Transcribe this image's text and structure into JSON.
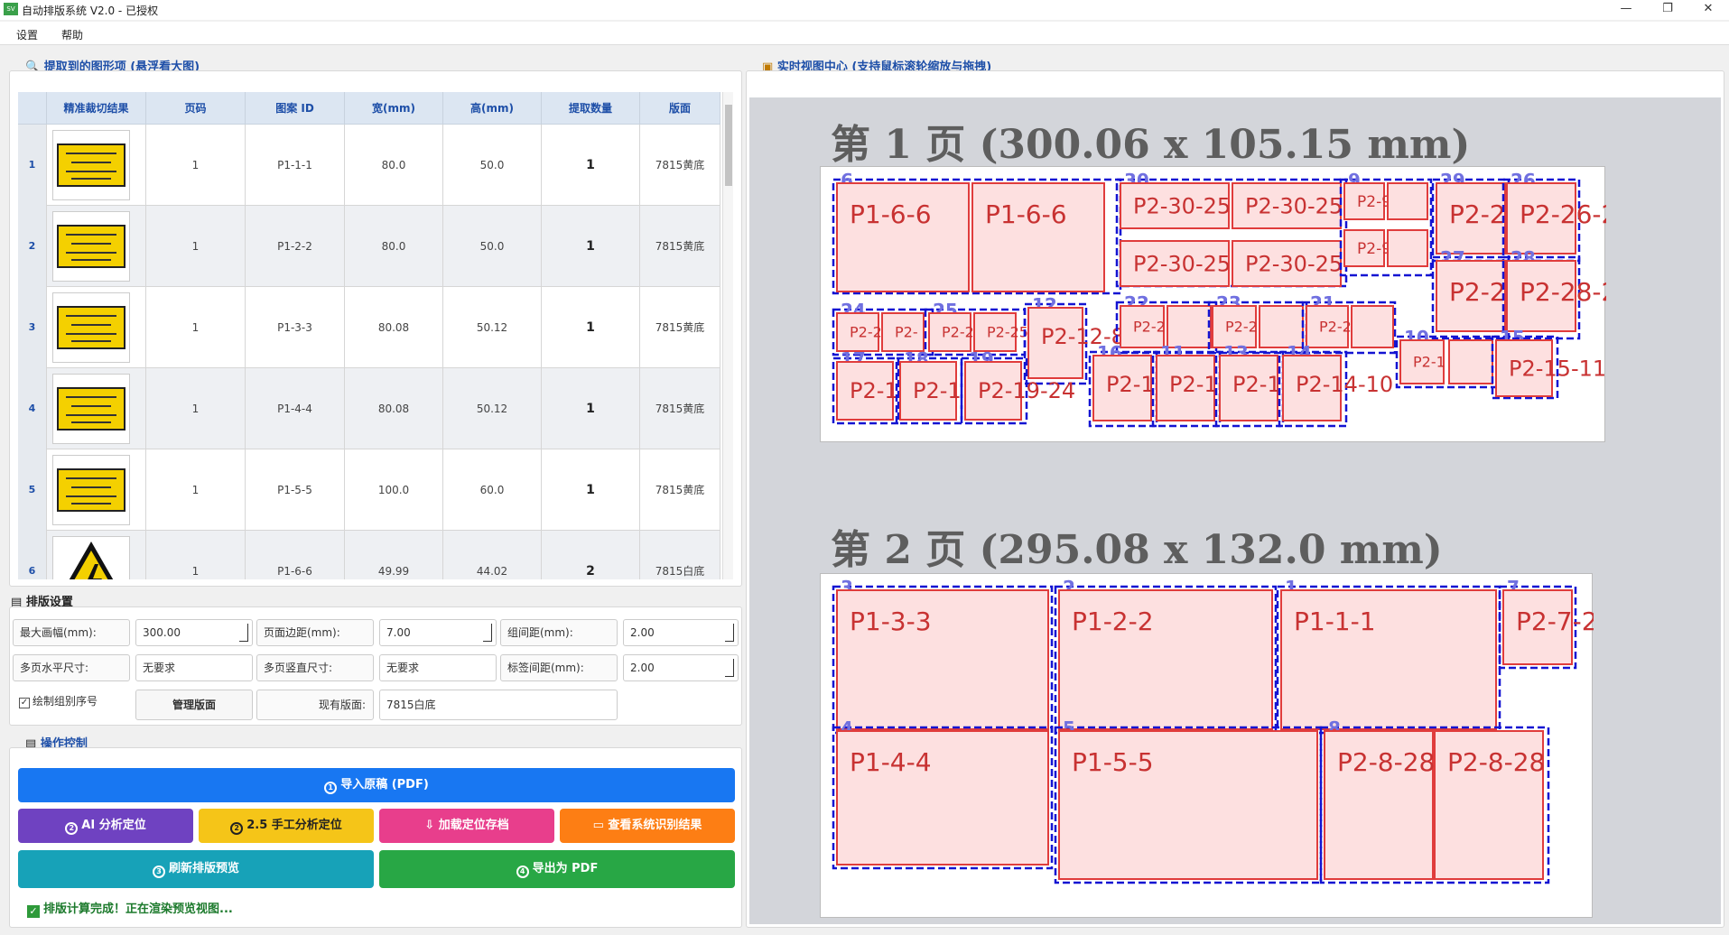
{
  "window": {
    "title": "自动排版系统 V2.0 - 已授权",
    "app_icon": "SV",
    "minimize": "—",
    "maximize": "❐",
    "close": "✕"
  },
  "menu": [
    "设置",
    "帮助"
  ],
  "left": {
    "extract_title": "提取到的图形项 (悬浮看大图)",
    "columns": [
      "",
      "精准裁切结果",
      "页码",
      "图案 ID",
      "宽(mm)",
      "高(mm)",
      "提取数量",
      "版面"
    ],
    "rows": [
      {
        "n": "1",
        "page": "1",
        "id": "P1-1-1",
        "w": "80.0",
        "h": "50.0",
        "qty": "1",
        "layout": "7815黄底"
      },
      {
        "n": "2",
        "page": "1",
        "id": "P1-2-2",
        "w": "80.0",
        "h": "50.0",
        "qty": "1",
        "layout": "7815黄底"
      },
      {
        "n": "3",
        "page": "1",
        "id": "P1-3-3",
        "w": "80.08",
        "h": "50.12",
        "qty": "1",
        "layout": "7815黄底"
      },
      {
        "n": "4",
        "page": "1",
        "id": "P1-4-4",
        "w": "80.08",
        "h": "50.12",
        "qty": "1",
        "layout": "7815黄底"
      },
      {
        "n": "5",
        "page": "1",
        "id": "P1-5-5",
        "w": "100.0",
        "h": "60.0",
        "qty": "1",
        "layout": "7815黄底"
      },
      {
        "n": "6",
        "page": "1",
        "id": "P1-6-6",
        "w": "49.99",
        "h": "44.02",
        "qty": "2",
        "layout": "7815白底"
      }
    ]
  },
  "settings": {
    "title": "排版设置",
    "max_width_label": "最大画幅(mm):",
    "max_width": "300.00",
    "margin_label": "页面边距(mm):",
    "margin": "7.00",
    "group_gap_label": "组间距(mm):",
    "group_gap": "2.00",
    "multi_h_label": "多页水平尺寸:",
    "multi_h": "无要求",
    "multi_v_label": "多页竖直尺寸:",
    "multi_v": "无要求",
    "label_gap_label": "标签间距(mm):",
    "label_gap": "2.00",
    "draw_seq_label": "绘制组别序号",
    "manage_btn": "管理版面",
    "current_layout_label": "现有版面:",
    "current_layout": "7815白底"
  },
  "ops": {
    "title": "操作控制",
    "import": "导入原稿 (PDF)",
    "ai": "AI 分析定位",
    "manual": "2.5 手工分析定位",
    "load": "加载定位存档",
    "view": "查看系统识别结果",
    "refresh": "刷新排版预览",
    "export": "导出为 PDF",
    "status": "排版计算完成！正在渲染预览视图..."
  },
  "preview": {
    "title": "实时视图中心 (支持鼠标滚轮缩放与拖拽)",
    "page1_title": "第 1 页 (300.06 x 105.15 mm)",
    "page2_title": "第 2 页 (295.08 x 132.0 mm)"
  },
  "colors": {
    "blue": "#1877f2",
    "purple": "#6f42c1",
    "yellow": "#f5c518",
    "pink": "#e83e8c",
    "orange": "#fd7e14",
    "teal": "#17a2b8",
    "green": "#28a745",
    "box_stroke": "#e03c3c",
    "box_fill": "#fde0e0",
    "group_stroke": "#1414d2"
  }
}
